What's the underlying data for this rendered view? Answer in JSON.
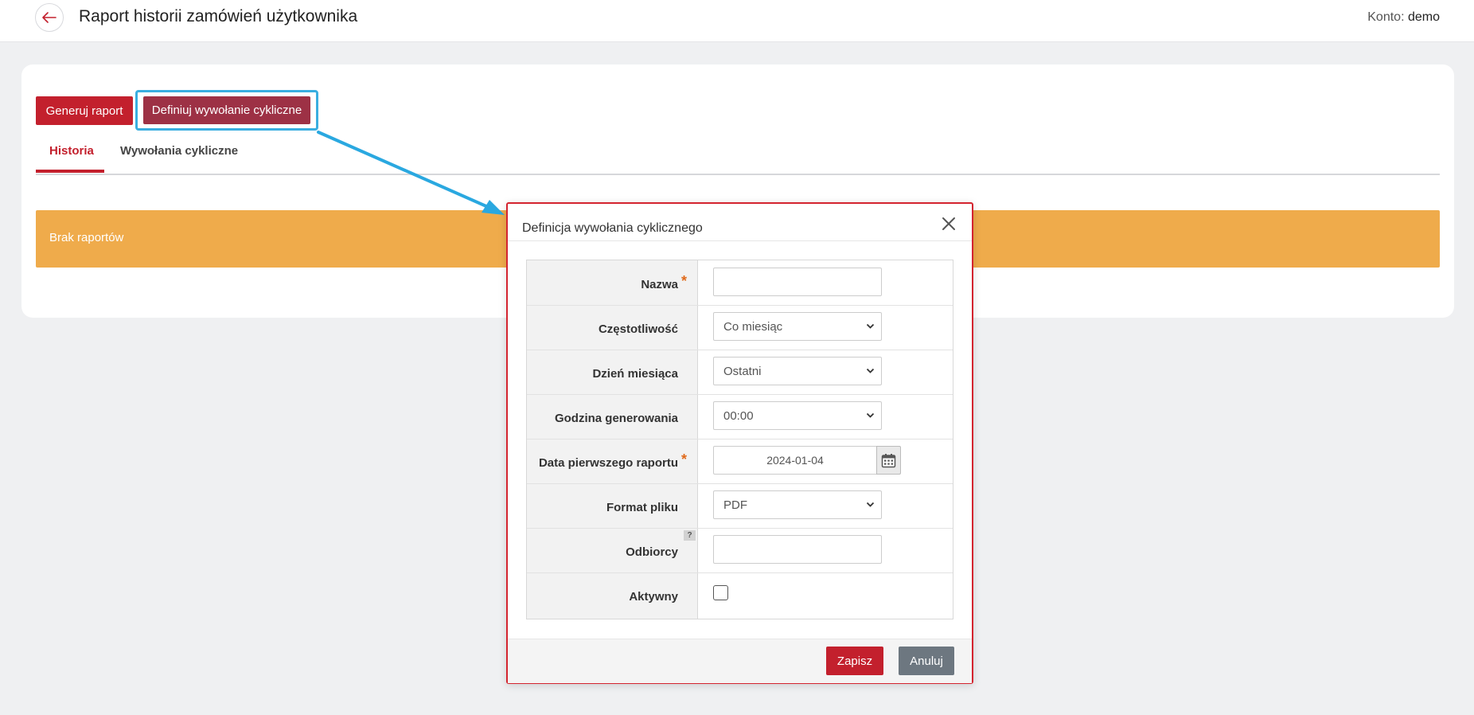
{
  "header": {
    "title": "Raport historii zamówień użytkownika",
    "account_label": "Konto:",
    "account_value": "demo"
  },
  "toolbar": {
    "generate_label": "Generuj raport",
    "define_label": "Definiuj wywołanie cykliczne"
  },
  "tabs": [
    {
      "label": "Historia",
      "active": true
    },
    {
      "label": "Wywołania cykliczne",
      "active": false
    }
  ],
  "banner": {
    "text": "Brak raportów"
  },
  "modal": {
    "title": "Definicja wywołania cyklicznego",
    "fields": {
      "name": {
        "label": "Nazwa",
        "required": "*",
        "value": ""
      },
      "frequency": {
        "label": "Częstotliwość",
        "value": "Co miesiąc"
      },
      "day": {
        "label": "Dzień miesiąca",
        "value": "Ostatni"
      },
      "hour": {
        "label": "Godzina generowania",
        "value": "00:00"
      },
      "first_date": {
        "label": "Data pierwszego raportu",
        "required": "*",
        "value": "2024-01-04"
      },
      "format": {
        "label": "Format pliku",
        "value": "PDF"
      },
      "recipients": {
        "label": "Odbiorcy",
        "help": "?",
        "value": ""
      },
      "active": {
        "label": "Aktywny",
        "checked": false
      }
    },
    "save_label": "Zapisz",
    "cancel_label": "Anuluj"
  },
  "colors": {
    "primary": "#c3202d",
    "highlight": "#3aaee0",
    "banner": "#efab4b",
    "cancel": "#6d7780"
  }
}
